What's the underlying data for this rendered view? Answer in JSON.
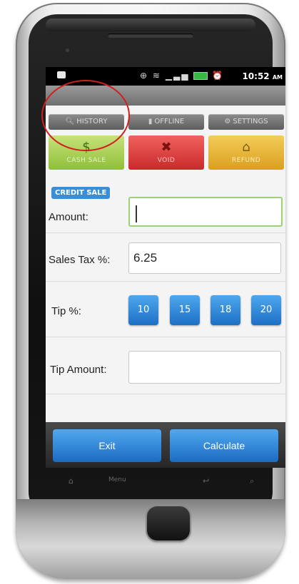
{
  "status_bar": {
    "time": "10:52",
    "ampm": "AM"
  },
  "nav": {
    "history": "HISTORY",
    "offline": "OFFLINE",
    "settings": "SETTINGS"
  },
  "actions": {
    "cash_sale": "CASH SALE",
    "void": "VOID",
    "refund": "REFUND"
  },
  "form": {
    "credit_badge": "CREDIT SALE",
    "amount_label": "Amount:",
    "amount_value": "",
    "sales_tax_label": "Sales Tax %:",
    "sales_tax_value": "6.25",
    "tip_label": "Tip %:",
    "tip_options": [
      "10",
      "15",
      "18",
      "20"
    ],
    "tip_amount_label": "Tip Amount:",
    "tip_amount_value": ""
  },
  "buttons": {
    "exit": "Exit",
    "calculate": "Calculate"
  },
  "softkeys": {
    "menu": "Menu"
  },
  "colors": {
    "accent_blue": "#2a85d8",
    "cash_green": "#9fcc48",
    "void_red": "#d83a3a",
    "refund_gold": "#e2ad2c",
    "annotation_red": "#d11f1f"
  }
}
